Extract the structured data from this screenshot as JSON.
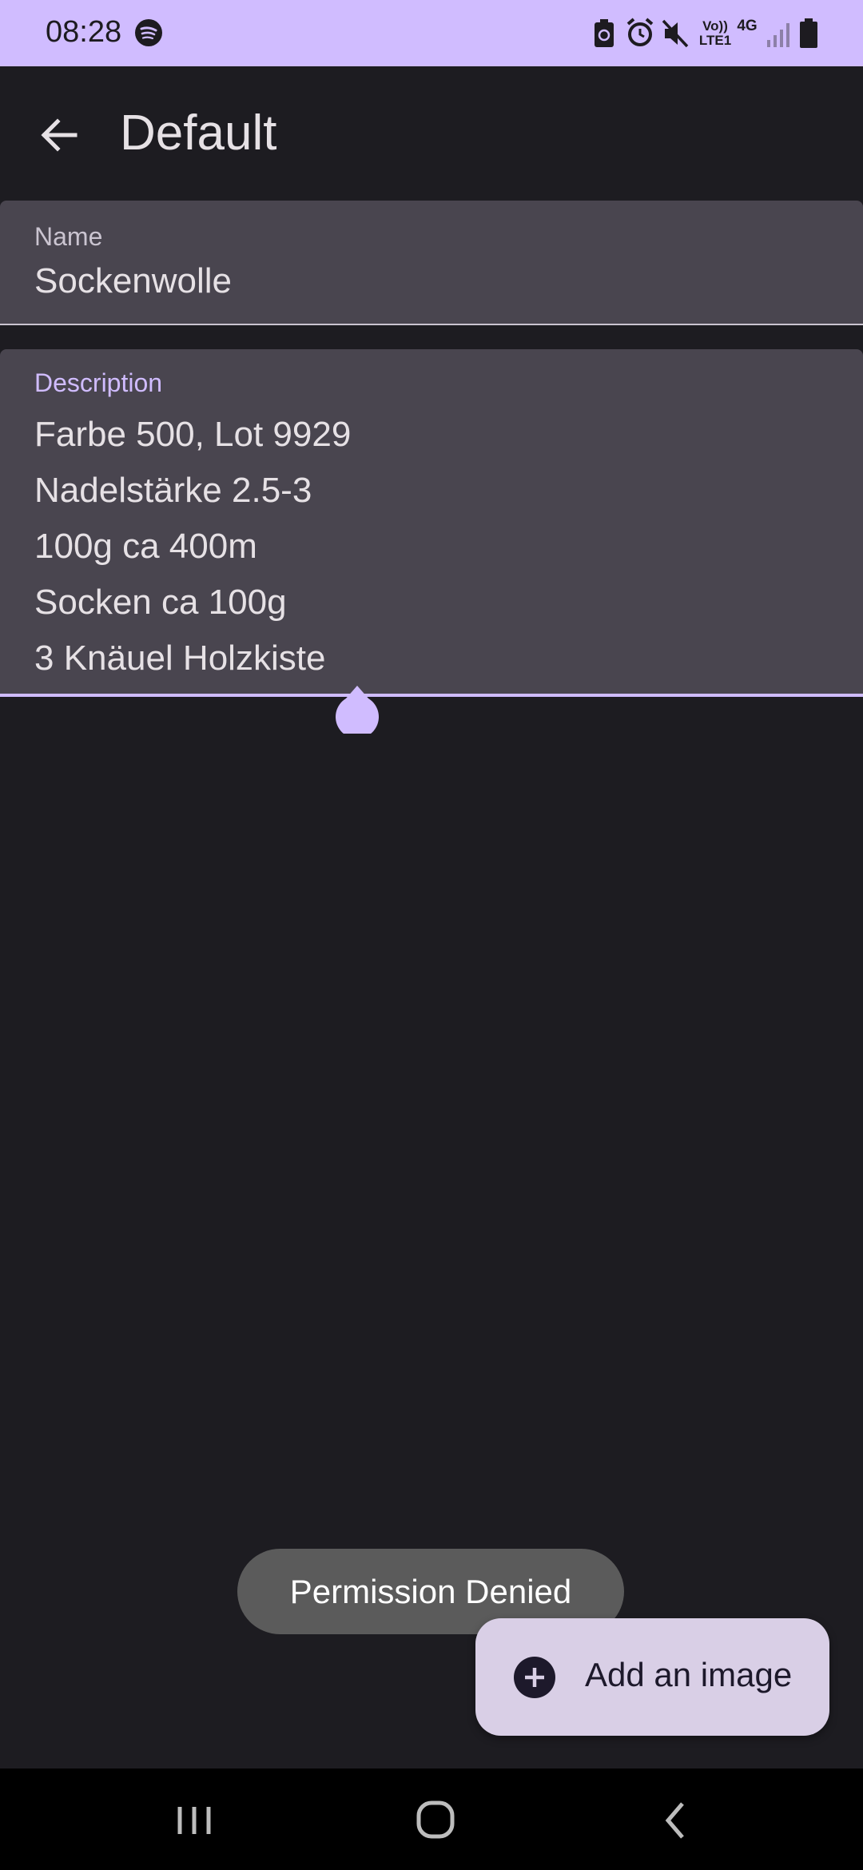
{
  "status_bar": {
    "time": "08:28",
    "lte_label": "Vo)) LTE1",
    "network_label": "4G",
    "icons": [
      "spotify-icon",
      "battery-saver-icon",
      "alarm-icon",
      "mute-icon",
      "signal-icon",
      "battery-icon"
    ]
  },
  "app_bar": {
    "title": "Default",
    "back_icon": "arrow-back-icon"
  },
  "name_field": {
    "label": "Name",
    "value": "Sockenwolle"
  },
  "description_field": {
    "label": "Description",
    "lines": [
      "Farbe 500, Lot 9929",
      "Nadelstärke 2.5-3",
      "100g ca 400m",
      "Socken ca 100g",
      "3 Knäuel Holzkiste"
    ]
  },
  "toast": {
    "text": "Permission Denied"
  },
  "fab": {
    "label": "Add an image",
    "icon": "add-circle-icon"
  },
  "nav_bar": {
    "icons": [
      "recents-icon",
      "home-icon",
      "back-icon"
    ]
  },
  "colors": {
    "accent": "#d0bcff",
    "background": "#1d1c21",
    "field_background": "#49454f",
    "fab_background": "#d9cfe6"
  }
}
